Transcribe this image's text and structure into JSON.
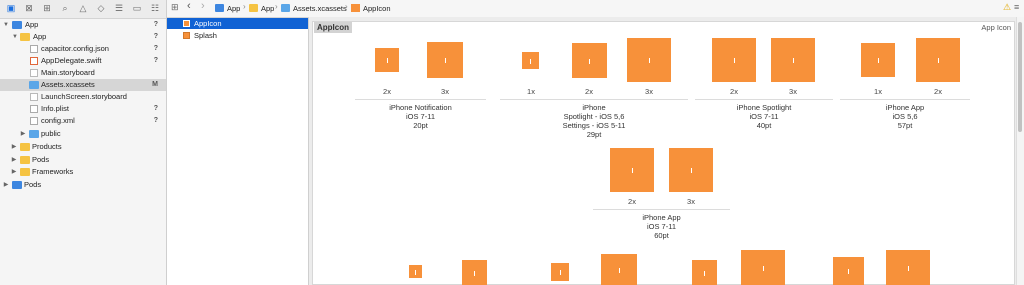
{
  "navigator": {
    "toolbar_icons": [
      "folder-icon",
      "source-control-icon",
      "hierarchy-icon",
      "search-icon",
      "warning-icon",
      "test-icon",
      "debug-icon",
      "breakpoint-icon",
      "report-icon"
    ],
    "tree": [
      {
        "label": "App",
        "badge": "?",
        "kind": "project",
        "disclosure": "▼"
      },
      {
        "label": "App",
        "badge": "?",
        "kind": "folder",
        "disclosure": "▼"
      },
      {
        "label": "capacitor.config.json",
        "badge": "?",
        "kind": "file"
      },
      {
        "label": "AppDelegate.swift",
        "badge": "?",
        "kind": "swift"
      },
      {
        "label": "Main.storyboard",
        "badge": "",
        "kind": "storyboard"
      },
      {
        "label": "Assets.xcassets",
        "badge": "M",
        "kind": "bluefolder",
        "selected": true
      },
      {
        "label": "LaunchScreen.storyboard",
        "badge": "",
        "kind": "storyboard"
      },
      {
        "label": "Info.plist",
        "badge": "?",
        "kind": "file"
      },
      {
        "label": "config.xml",
        "badge": "?",
        "kind": "file"
      },
      {
        "label": "public",
        "badge": "",
        "kind": "bluefolder",
        "disclosure": "▶"
      },
      {
        "label": "Products",
        "badge": "",
        "kind": "folder",
        "disclosure": "▶"
      },
      {
        "label": "Pods",
        "badge": "",
        "kind": "folder",
        "disclosure": "▶"
      },
      {
        "label": "Frameworks",
        "badge": "",
        "kind": "folder",
        "disclosure": "▶"
      },
      {
        "label": "Pods",
        "badge": "",
        "kind": "project",
        "disclosure": "▶"
      }
    ]
  },
  "asset_list": [
    {
      "label": "AppIcon",
      "selected": true
    },
    {
      "label": "Splash",
      "selected": false
    }
  ],
  "jumpbar": {
    "crumbs": [
      "App",
      "App",
      "Assets.xcassets",
      "AppIcon"
    ],
    "back_glyph": "‹",
    "forward_glyph": "›",
    "warning_glyph": "⚠"
  },
  "editor": {
    "set_name": "AppIcon",
    "set_type": "App Icon",
    "groups": [
      {
        "caption": "iPhone Notification\niOS 7-11\n20pt",
        "scales": [
          "2x",
          "3x"
        ]
      },
      {
        "caption": "iPhone\nSpotlight - iOS 5,6\nSettings - iOS 5-11\n29pt",
        "scales": [
          "1x",
          "2x",
          "3x"
        ]
      },
      {
        "caption": "iPhone Spotlight\niOS 7-11\n40pt",
        "scales": [
          "2x",
          "3x"
        ]
      },
      {
        "caption": "iPhone App\niOS 5,6\n57pt",
        "scales": [
          "1x",
          "2x"
        ]
      },
      {
        "caption": "iPhone App\niOS 7-11\n60pt",
        "scales": [
          "2x",
          "3x"
        ]
      }
    ]
  },
  "colors": {
    "accent": "#1062d4",
    "icon_slot": "#f7913a",
    "folder": "#f5c342",
    "blue_folder": "#5aa6e8"
  }
}
